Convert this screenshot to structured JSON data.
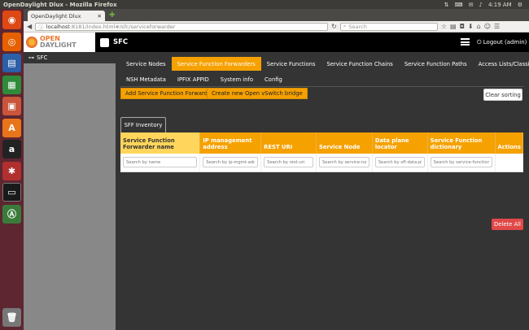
{
  "window": {
    "title": "OpenDaylight Dlux - Mozilla Firefox",
    "clock": "4:19 AM"
  },
  "browser": {
    "tab_title": "OpenDaylight Dlux",
    "url_host": "localhost",
    "url_path": ":8181/index.html#/sfc/serviceforwarder",
    "search_placeholder": "Search"
  },
  "app": {
    "logo_top": "OPEN",
    "logo_bottom": "DAYLIGHT",
    "name": "SFC",
    "logout": "Logout (admin)"
  },
  "sidebar": {
    "item": "SFC"
  },
  "menu_row1": [
    "Service Nodes",
    "Service Function Forwarders",
    "Service Functions",
    "Service Function Chains",
    "Service Function Paths",
    "Access Lists/Classifiers"
  ],
  "menu_row2": [
    "NSH Metadata",
    "IPFIX APPID",
    "System info",
    "Config"
  ],
  "active_menu": "Service Function Forwarders",
  "actions": {
    "add": "Add Service Function Forwarder",
    "create_ovs": "Create new Open vSwitch bridge",
    "clear": "Clear sorting",
    "delete_all": "Delete All"
  },
  "inventory_tab": "SFF Inventory",
  "table": {
    "headers": [
      "Service Function Forwarder name",
      "IP management address",
      "REST URI",
      "Service Node",
      "Data plane locator",
      "Service Function dictionary",
      "Actions"
    ],
    "filters": [
      "Search by name",
      "Search by ip-mgmt-address",
      "Search by rest-uri",
      "Search by service-node",
      "Search by sff-data-plan",
      "Search by service-function-dict"
    ]
  },
  "colors": {
    "accent": "#f5a100",
    "danger": "#e14848",
    "header_bg": "#000000",
    "launcher_bg": "#5e2630"
  }
}
